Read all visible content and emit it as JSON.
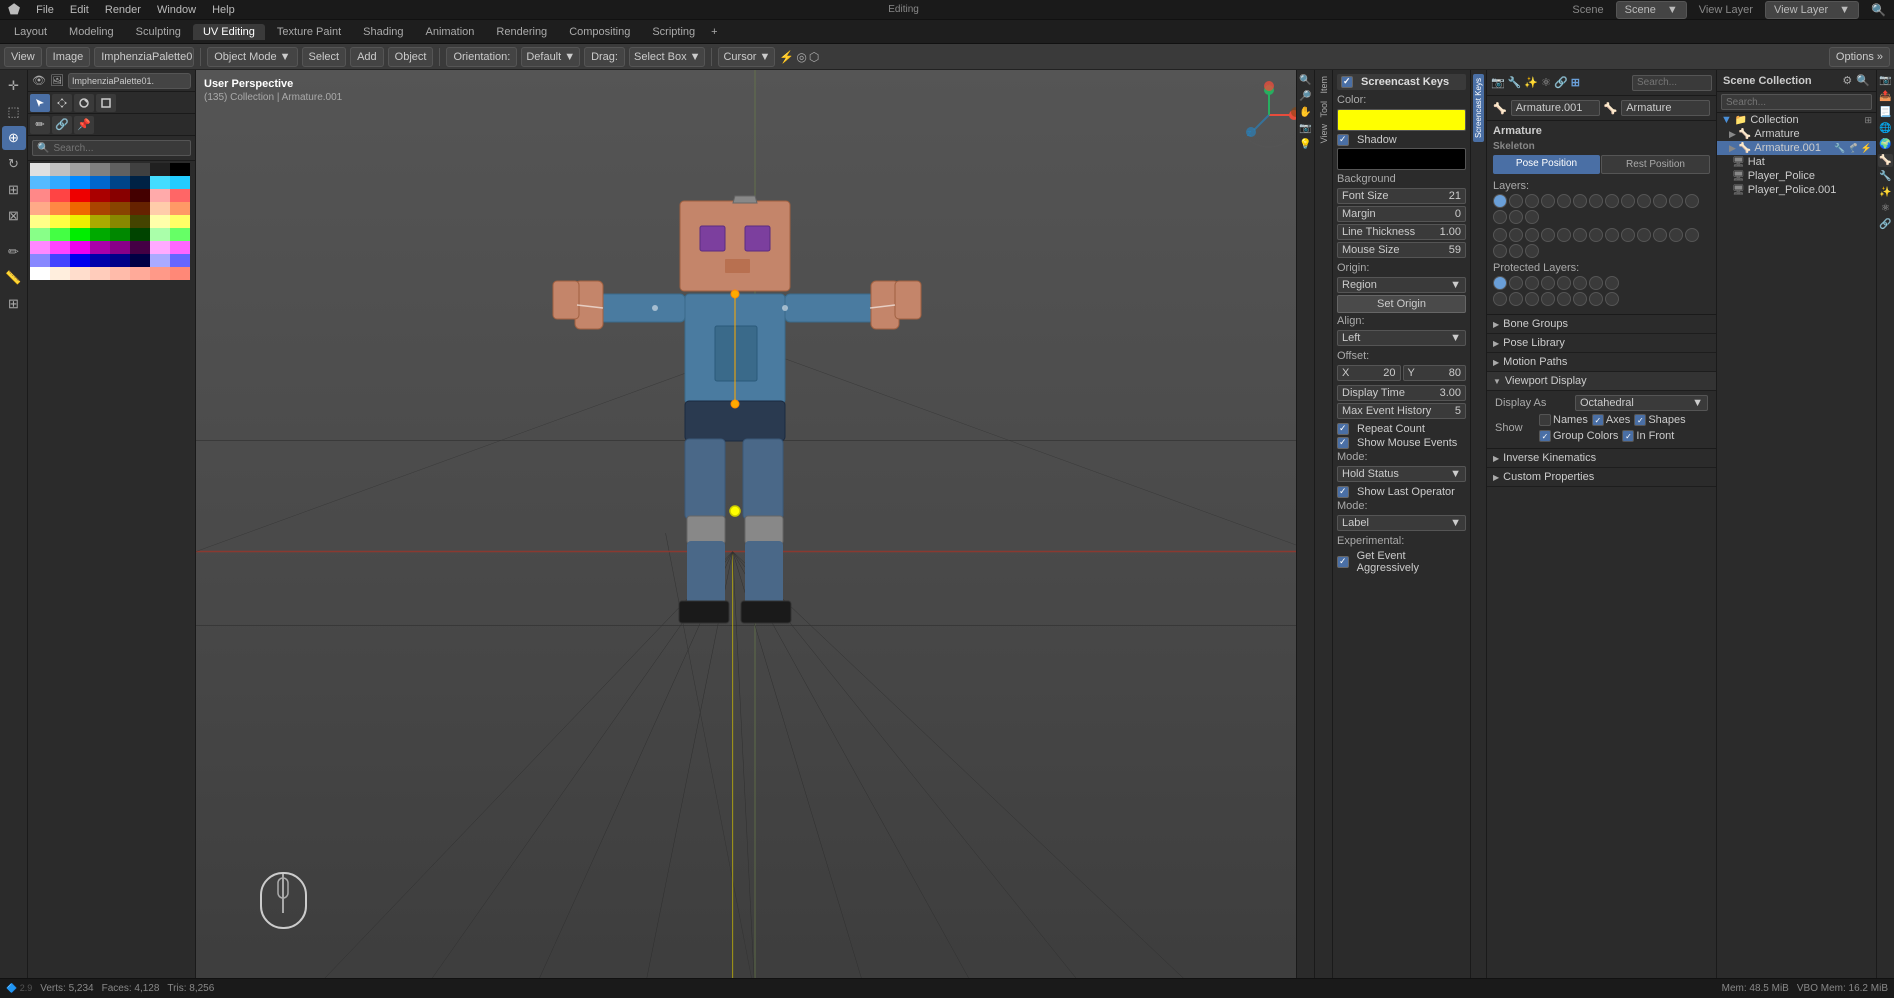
{
  "app": {
    "title": "Blender",
    "mode": "Editing"
  },
  "top_menu": {
    "items": [
      "File",
      "Edit",
      "Render",
      "Window",
      "Help"
    ]
  },
  "workspace_tabs": {
    "tabs": [
      "Layout",
      "Modeling",
      "Sculpting",
      "UV Editing",
      "Texture Paint",
      "Shading",
      "Animation",
      "Rendering",
      "Compositing",
      "Scripting"
    ],
    "active": "UV Editing"
  },
  "header_toolbar": {
    "orientation_label": "Orientation:",
    "orientation_value": "Default",
    "drag_label": "Drag:",
    "drag_value": "Select Box",
    "cursor_label": "Cursor",
    "options_label": "Options »",
    "view_label": "View",
    "image_label": "Image",
    "palette_label": "ImphenziaPalette01.",
    "object_mode": "Object Mode",
    "select_label": "Select",
    "add_label": "Add",
    "object_label": "Object"
  },
  "viewport": {
    "perspective": "User Perspective",
    "collection": "(135) Collection | Armature.001"
  },
  "left_tools": {
    "tools": [
      "cursor",
      "move",
      "rotate",
      "scale",
      "transform",
      "annotate",
      "measure",
      "add"
    ]
  },
  "color_palette": {
    "swatches": [
      "#e0e0e0",
      "#c0c0c0",
      "#a0a0a0",
      "#808080",
      "#606060",
      "#404040",
      "#202020",
      "#101010",
      "#5bf",
      "#3af",
      "#08f",
      "#06c",
      "#048",
      "#024",
      "#4df",
      "#2cf",
      "#f88",
      "#f44",
      "#e00",
      "#a00",
      "#800",
      "#400",
      "#faa",
      "#f66",
      "#fa8",
      "#f84",
      "#e60",
      "#a40",
      "#840",
      "#620",
      "#fca",
      "#f96",
      "#ff8",
      "#ff4",
      "#ee0",
      "#aa0",
      "#880",
      "#440",
      "#ffa",
      "#ff6",
      "#8f8",
      "#4f4",
      "#0e0",
      "#0a0",
      "#080",
      "#040",
      "#afa",
      "#6f6",
      "#f8f",
      "#f4f",
      "#e0e",
      "#a0a",
      "#808",
      "#404",
      "#faf",
      "#f6f",
      "#88f",
      "#44f",
      "#00e",
      "#00a",
      "#008",
      "#004",
      "#aaf",
      "#66f",
      "#fff",
      "#fee",
      "#fdd",
      "#fcc",
      "#fbb",
      "#faa",
      "#f99",
      "#f88"
    ]
  },
  "screencast_keys": {
    "title": "Screencast Keys",
    "color_label": "Color:",
    "color_value": "#ffff00",
    "shadow_label": "Shadow",
    "shadow_color": "#000000",
    "background_label": "Background",
    "font_size_label": "Font Size",
    "font_size_value": "21",
    "margin_label": "Margin",
    "margin_value": "0",
    "line_thickness_label": "Line Thickness",
    "line_thickness_value": "1.00",
    "mouse_size_label": "Mouse Size",
    "mouse_size_value": "59",
    "origin_label": "Origin:",
    "origin_value": "Region",
    "set_origin_btn": "Set Origin",
    "align_label": "Align:",
    "align_value": "Left",
    "offset_label": "Offset:",
    "offset_x_label": "X",
    "offset_x_value": "20",
    "offset_y_label": "Y",
    "offset_y_value": "80",
    "display_time_label": "Display Time",
    "display_time_value": "3.00",
    "max_event_history_label": "Max Event History",
    "max_event_history_value": "5",
    "repeat_count_label": "Repeat Count",
    "show_mouse_events_label": "Show Mouse Events",
    "mode_label": "Mode:",
    "mode_value_mouse": "Hold Status",
    "show_last_operator_label": "Show Last Operator",
    "mode_value_operator": "Label",
    "experimental_label": "Experimental:",
    "get_event_aggressively_label": "Get Event Aggressively"
  },
  "armature_panel": {
    "title": "Armature",
    "armature_name": "Armature.001",
    "armature_parent": "Armature",
    "pose_position_label": "Pose Position",
    "rest_position_label": "Rest Position",
    "layers_label": "Layers:",
    "protected_layers_label": "Protected Layers:",
    "bone_groups_label": "Bone Groups",
    "pose_library_label": "Pose Library",
    "motion_paths_label": "Motion Paths",
    "viewport_display_label": "Viewport Display",
    "display_as_label": "Display As",
    "display_as_value": "Octahedral",
    "show_label": "Show",
    "names_label": "Names",
    "axes_label": "Axes",
    "shapes_label": "Shapes",
    "group_colors_label": "Group Colors",
    "in_front_label": "In Front",
    "inverse_kinematics_label": "Inverse Kinematics",
    "custom_properties_label": "Custom Properties"
  },
  "outliner": {
    "title": "Scene Collection",
    "items": [
      {
        "name": "Collection",
        "level": 0,
        "icon": "collection",
        "expanded": true
      },
      {
        "name": "Armature",
        "level": 1,
        "icon": "armature"
      },
      {
        "name": "Armature.001",
        "level": 1,
        "icon": "armature",
        "selected": true
      },
      {
        "name": "Hat",
        "level": 1,
        "icon": "mesh"
      },
      {
        "name": "Player_Police",
        "level": 1,
        "icon": "mesh"
      },
      {
        "name": "Player_Police.001",
        "level": 1,
        "icon": "mesh"
      }
    ]
  },
  "scene_label": "Scene",
  "view_layer_label": "View Layer",
  "options_btn": "Options »"
}
